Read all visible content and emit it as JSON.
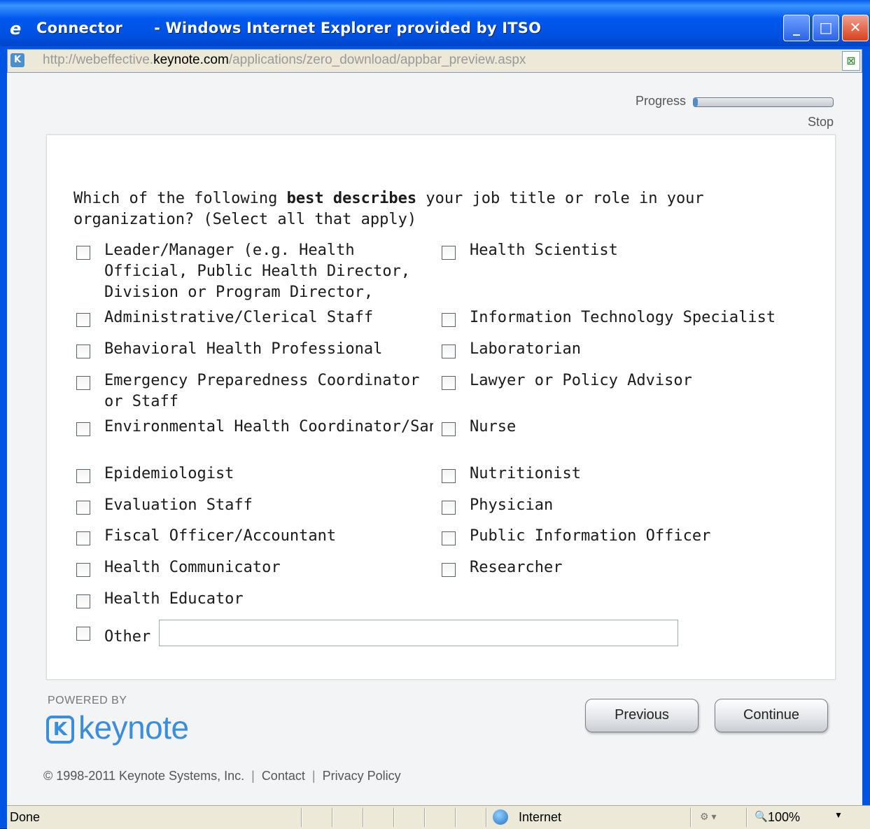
{
  "window": {
    "title": "Connector      - Windows Internet Explorer provided by ITSO",
    "address": {
      "prefix": "http://webeffective.",
      "domain": "keynote.com",
      "path": "/applications/zero_download/appbar_preview.aspx"
    }
  },
  "header": {
    "progress_label": "Progress",
    "progress_value": 0.03,
    "stop_label": "Stop"
  },
  "question": {
    "text_before": "Which of the following ",
    "text_bold": "best describes",
    "text_after": " your job title or role in your organization? (Select all that apply)"
  },
  "options_left": [
    "Leader/Manager (e.g. Health Official, Public Health Director, Division or Program Director, etc.)",
    "Administrative/Clerical Staff",
    "Behavioral Health Professional",
    "Emergency Preparedness Coordinator or Staff",
    "Environmental Health Coordinator/Sanitarian/Specialist/Scientist",
    "Epidemiologist",
    "Evaluation Staff",
    "Fiscal Officer/Accountant",
    "Health Communicator",
    "Health Educator"
  ],
  "options_right": [
    "Health Scientist",
    "Information Technology Specialist",
    "Laboratorian",
    "Lawyer or Policy Advisor",
    "Nurse",
    "Nutritionist",
    "Physician",
    "Public Information Officer",
    "Researcher"
  ],
  "other": {
    "label": "Other",
    "value": ""
  },
  "branding": {
    "powered_by": "POWERED BY",
    "logo_text": "keynote",
    "brand_color": "#3A8EDC"
  },
  "buttons": {
    "previous": "Previous",
    "continue": "Continue"
  },
  "footer": {
    "copyright": "© 1998-2011 Keynote Systems, Inc.",
    "contact": "Contact",
    "privacy": "Privacy Policy"
  },
  "statusbar": {
    "status": "Done",
    "zone": "Internet",
    "zoom": "100%"
  }
}
